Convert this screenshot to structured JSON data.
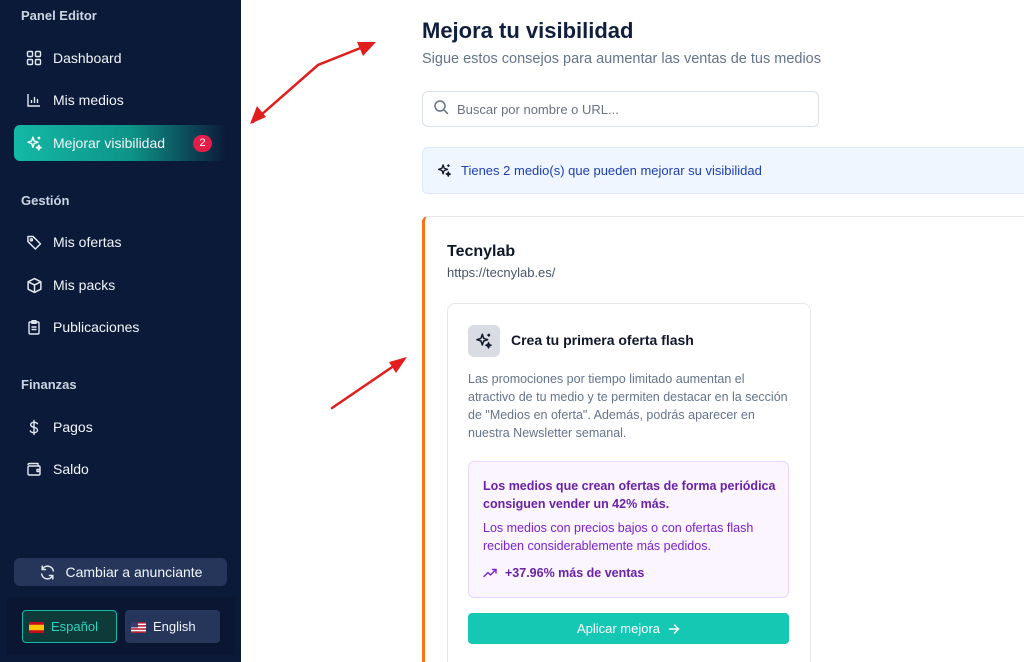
{
  "sidebar": {
    "panel_title": "Panel Editor",
    "items_main": [
      {
        "label": "Dashboard",
        "icon": "grid-icon"
      },
      {
        "label": "Mis medios",
        "icon": "bar-chart-icon"
      },
      {
        "label": "Mejorar visibilidad",
        "icon": "sparkles-icon",
        "badge": "2",
        "active": true
      }
    ],
    "section_gestion": "Gestión",
    "items_gestion": [
      {
        "label": "Mis ofertas",
        "icon": "tag-icon"
      },
      {
        "label": "Mis packs",
        "icon": "box-icon"
      },
      {
        "label": "Publicaciones",
        "icon": "clipboard-icon"
      }
    ],
    "section_finanzas": "Finanzas",
    "items_finanzas": [
      {
        "label": "Pagos",
        "icon": "dollar-icon"
      },
      {
        "label": "Saldo",
        "icon": "wallet-icon"
      }
    ],
    "switch_label": "Cambiar a anunciante",
    "languages": [
      {
        "label": "Español",
        "selected": true
      },
      {
        "label": "English",
        "selected": false
      }
    ]
  },
  "main": {
    "title": "Mejora tu visibilidad",
    "subtitle": "Sigue estos consejos para aumentar las ventas de tus medios",
    "search_placeholder": "Buscar por nombre o URL...",
    "info_banner": "Tienes 2 medio(s) que pueden mejorar su visibilidad",
    "media": {
      "name": "Tecnylab",
      "url": "https://tecnylab.es/",
      "tip": {
        "title": "Crea tu primera oferta flash",
        "description": "Las promociones por tiempo limitado aumentan el atractivo de tu medio y te permiten destacar en la sección de \"Medios en oferta\". Además, podrás aparecer en nuestra Newsletter semanal.",
        "stat_highlight": "Los medios que crean ofertas de forma periódica consiguen vender un 42% más.",
        "stat_text": "Los medios con precios bajos o con ofertas flash reciben considerablemente más pedidos.",
        "growth": "+37.96% más de ventas",
        "apply_label": "Aplicar mejora"
      }
    }
  },
  "colors": {
    "sidebar_bg": "#0c1a3a",
    "accent": "#14b8a6",
    "badge": "#e11d48",
    "card_border": "#f97316",
    "annotation_arrow": "#e11d1d"
  }
}
